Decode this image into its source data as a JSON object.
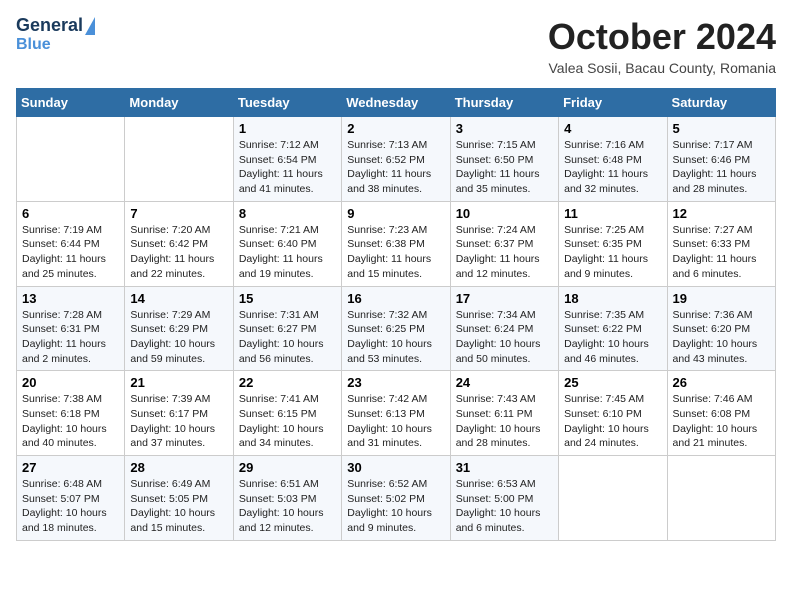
{
  "header": {
    "logo_line1": "General",
    "logo_line2": "Blue",
    "month": "October 2024",
    "location": "Valea Sosii, Bacau County, Romania"
  },
  "days_of_week": [
    "Sunday",
    "Monday",
    "Tuesday",
    "Wednesday",
    "Thursday",
    "Friday",
    "Saturday"
  ],
  "weeks": [
    [
      {
        "day": "",
        "content": ""
      },
      {
        "day": "",
        "content": ""
      },
      {
        "day": "1",
        "content": "Sunrise: 7:12 AM\nSunset: 6:54 PM\nDaylight: 11 hours and 41 minutes."
      },
      {
        "day": "2",
        "content": "Sunrise: 7:13 AM\nSunset: 6:52 PM\nDaylight: 11 hours and 38 minutes."
      },
      {
        "day": "3",
        "content": "Sunrise: 7:15 AM\nSunset: 6:50 PM\nDaylight: 11 hours and 35 minutes."
      },
      {
        "day": "4",
        "content": "Sunrise: 7:16 AM\nSunset: 6:48 PM\nDaylight: 11 hours and 32 minutes."
      },
      {
        "day": "5",
        "content": "Sunrise: 7:17 AM\nSunset: 6:46 PM\nDaylight: 11 hours and 28 minutes."
      }
    ],
    [
      {
        "day": "6",
        "content": "Sunrise: 7:19 AM\nSunset: 6:44 PM\nDaylight: 11 hours and 25 minutes."
      },
      {
        "day": "7",
        "content": "Sunrise: 7:20 AM\nSunset: 6:42 PM\nDaylight: 11 hours and 22 minutes."
      },
      {
        "day": "8",
        "content": "Sunrise: 7:21 AM\nSunset: 6:40 PM\nDaylight: 11 hours and 19 minutes."
      },
      {
        "day": "9",
        "content": "Sunrise: 7:23 AM\nSunset: 6:38 PM\nDaylight: 11 hours and 15 minutes."
      },
      {
        "day": "10",
        "content": "Sunrise: 7:24 AM\nSunset: 6:37 PM\nDaylight: 11 hours and 12 minutes."
      },
      {
        "day": "11",
        "content": "Sunrise: 7:25 AM\nSunset: 6:35 PM\nDaylight: 11 hours and 9 minutes."
      },
      {
        "day": "12",
        "content": "Sunrise: 7:27 AM\nSunset: 6:33 PM\nDaylight: 11 hours and 6 minutes."
      }
    ],
    [
      {
        "day": "13",
        "content": "Sunrise: 7:28 AM\nSunset: 6:31 PM\nDaylight: 11 hours and 2 minutes."
      },
      {
        "day": "14",
        "content": "Sunrise: 7:29 AM\nSunset: 6:29 PM\nDaylight: 10 hours and 59 minutes."
      },
      {
        "day": "15",
        "content": "Sunrise: 7:31 AM\nSunset: 6:27 PM\nDaylight: 10 hours and 56 minutes."
      },
      {
        "day": "16",
        "content": "Sunrise: 7:32 AM\nSunset: 6:25 PM\nDaylight: 10 hours and 53 minutes."
      },
      {
        "day": "17",
        "content": "Sunrise: 7:34 AM\nSunset: 6:24 PM\nDaylight: 10 hours and 50 minutes."
      },
      {
        "day": "18",
        "content": "Sunrise: 7:35 AM\nSunset: 6:22 PM\nDaylight: 10 hours and 46 minutes."
      },
      {
        "day": "19",
        "content": "Sunrise: 7:36 AM\nSunset: 6:20 PM\nDaylight: 10 hours and 43 minutes."
      }
    ],
    [
      {
        "day": "20",
        "content": "Sunrise: 7:38 AM\nSunset: 6:18 PM\nDaylight: 10 hours and 40 minutes."
      },
      {
        "day": "21",
        "content": "Sunrise: 7:39 AM\nSunset: 6:17 PM\nDaylight: 10 hours and 37 minutes."
      },
      {
        "day": "22",
        "content": "Sunrise: 7:41 AM\nSunset: 6:15 PM\nDaylight: 10 hours and 34 minutes."
      },
      {
        "day": "23",
        "content": "Sunrise: 7:42 AM\nSunset: 6:13 PM\nDaylight: 10 hours and 31 minutes."
      },
      {
        "day": "24",
        "content": "Sunrise: 7:43 AM\nSunset: 6:11 PM\nDaylight: 10 hours and 28 minutes."
      },
      {
        "day": "25",
        "content": "Sunrise: 7:45 AM\nSunset: 6:10 PM\nDaylight: 10 hours and 24 minutes."
      },
      {
        "day": "26",
        "content": "Sunrise: 7:46 AM\nSunset: 6:08 PM\nDaylight: 10 hours and 21 minutes."
      }
    ],
    [
      {
        "day": "27",
        "content": "Sunrise: 6:48 AM\nSunset: 5:07 PM\nDaylight: 10 hours and 18 minutes."
      },
      {
        "day": "28",
        "content": "Sunrise: 6:49 AM\nSunset: 5:05 PM\nDaylight: 10 hours and 15 minutes."
      },
      {
        "day": "29",
        "content": "Sunrise: 6:51 AM\nSunset: 5:03 PM\nDaylight: 10 hours and 12 minutes."
      },
      {
        "day": "30",
        "content": "Sunrise: 6:52 AM\nSunset: 5:02 PM\nDaylight: 10 hours and 9 minutes."
      },
      {
        "day": "31",
        "content": "Sunrise: 6:53 AM\nSunset: 5:00 PM\nDaylight: 10 hours and 6 minutes."
      },
      {
        "day": "",
        "content": ""
      },
      {
        "day": "",
        "content": ""
      }
    ]
  ]
}
